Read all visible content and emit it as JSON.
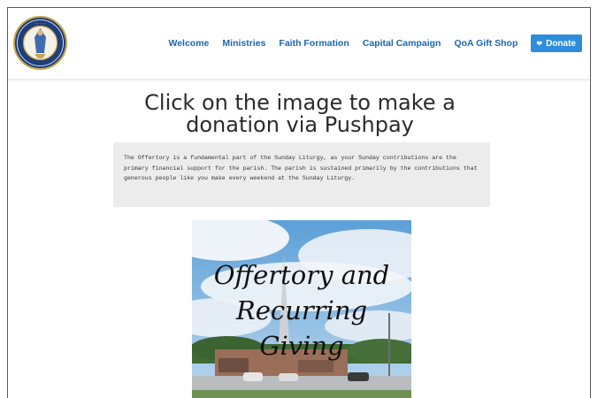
{
  "header": {
    "logo_icon": "parish-seal-logo",
    "nav": [
      {
        "label": "Welcome"
      },
      {
        "label": "Ministries"
      },
      {
        "label": "Faith Formation"
      },
      {
        "label": "Capital Campaign"
      },
      {
        "label": "QoA Gift Shop"
      }
    ],
    "donate": {
      "label": "Donate",
      "icon": "heart-icon"
    },
    "colors": {
      "link": "#1b67b2",
      "button": "#2e8ddb",
      "seal_blue": "#1f3f7a",
      "seal_gold": "#c9a64a"
    }
  },
  "main": {
    "title": "Click on the image to make a donation via Pushpay",
    "quote": "The Offertory is a fundamental part of the Sunday Liturgy, as your Sunday contributions are the primary financial support for the parish. The parish is sustained primarily by the contributions that generous people like you make every weekend at the Sunday Liturgy.",
    "image": {
      "lines": [
        "Offertory and",
        "Recurring",
        "Giving"
      ]
    }
  }
}
